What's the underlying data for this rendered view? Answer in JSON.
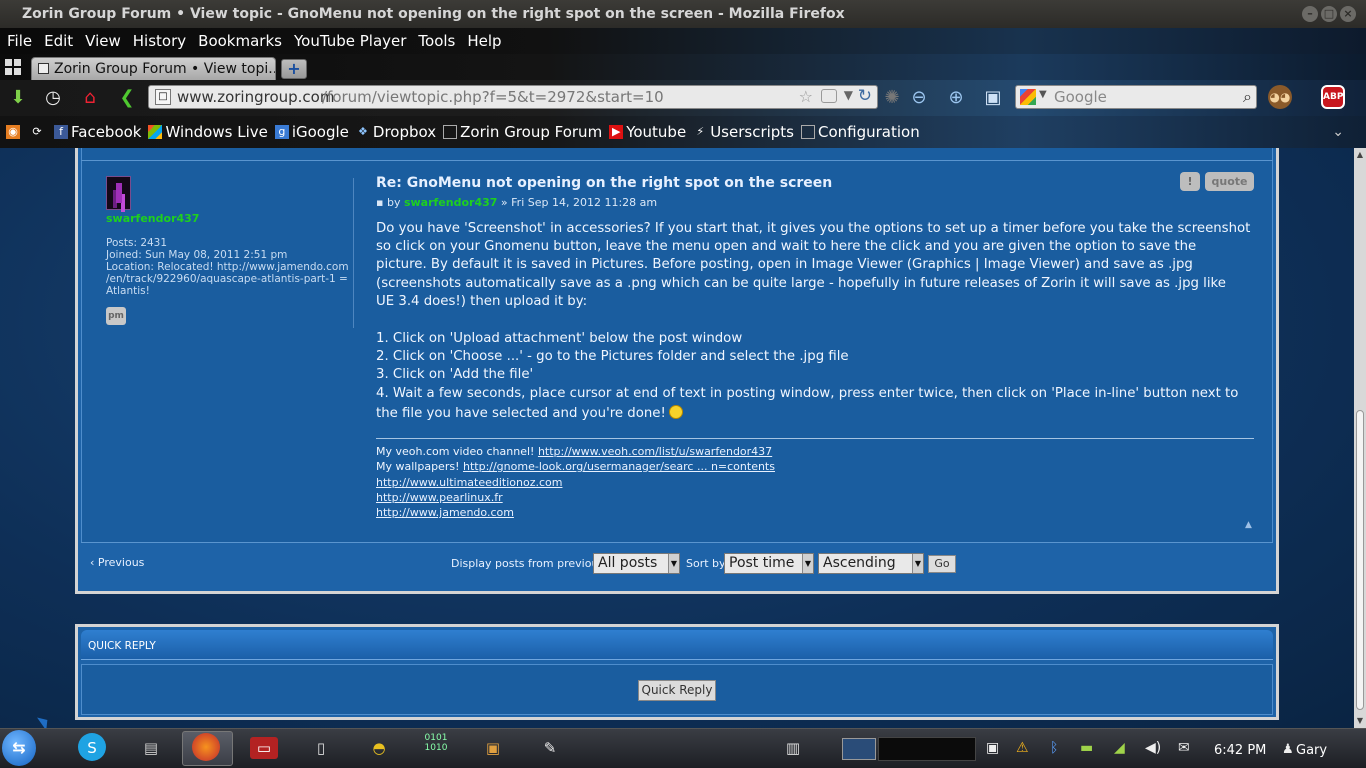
{
  "window": {
    "title": "Zorin Group Forum • View topic - GnoMenu not opening on the right spot on the screen - Mozilla Firefox"
  },
  "menubar": {
    "items": [
      "File",
      "Edit",
      "View",
      "History",
      "Bookmarks",
      "YouTube Player",
      "Tools",
      "Help"
    ]
  },
  "tabs": {
    "active_label": "Zorin Group Forum • View topi...",
    "new_tab_label": "+"
  },
  "navbar": {
    "url_host": "www.zoringroup.com",
    "url_path": "/forum/viewtopic.php?f=5&t=2972&start=10",
    "search_placeholder": "Google",
    "abp_label": "ABP"
  },
  "bookmarks": {
    "items": [
      "Facebook",
      "Windows Live",
      "iGoogle",
      "Dropbox",
      "Zorin Group Forum",
      "Youtube",
      "Userscripts",
      "Configuration"
    ]
  },
  "post": {
    "author": "swarfendor437",
    "profile": {
      "posts": "Posts: 2431",
      "joined": "Joined: Sun May 08, 2011 2:51 pm",
      "location_1": "Location: Relocated! http://www.jamendo.com",
      "location_2": "/en/track/922960/aquascape-atlantis-part-1 =",
      "location_3": "Atlantis!"
    },
    "pm_label": "pm",
    "report_label": "!",
    "quote_label": "quote",
    "title": "Re: GnoMenu not opening on the right spot on the screen",
    "meta_by": "by",
    "meta_date": "» Fri Sep 14, 2012 11:28 am",
    "body_lines": [
      "Do you have 'Screenshot' in accessories? If you start that, it gives you the options to set up a timer before you take the screenshot",
      "so click on your Gnomenu button, leave the menu open and wait to here the click and you are given the option to save the",
      "picture. By default it is saved in Pictures. Before posting, open in Image Viewer (Graphics | Image Viewer) and save as .jpg",
      "(screenshots automatically save as a .png which can be quite large - hopefully in future releases of Zorin it will save as .jpg like",
      "UE 3.4 does!) then upload it by:"
    ],
    "steps": [
      "1. Click on 'Upload attachment' below the post window",
      "2. Click on 'Choose ...' - go to the Pictures folder and select the .jpg file",
      "3. Click on 'Add the file'",
      "4. Wait a few seconds, place cursor at end of text in posting window, press enter twice, then click on 'Place in-line' button next to",
      "the file you have selected and you're done!"
    ],
    "signature": {
      "veoh_label": "My veoh.com video channel!",
      "veoh_link": "http://www.veoh.com/list/u/swarfendor437",
      "wallpapers_label": "My wallpapers!",
      "wallpapers_link": "http://gnome-look.org/usermanager/searc ... n=contents",
      "links": [
        "http://www.ultimateeditionoz.com",
        "http://www.pearlinux.fr",
        "http://www.jamendo.com"
      ]
    }
  },
  "pagination": {
    "previous": "Previous",
    "display_label": "Display posts from previous:",
    "display_value": "All posts",
    "sort_label": "Sort by",
    "sort_value": "Post time",
    "order_value": "Ascending",
    "go_label": "Go"
  },
  "quick_reply": {
    "title": "QUICK REPLY",
    "button": "Quick Reply"
  },
  "taskbar": {
    "clock": "6:42 PM",
    "user": "Gary"
  }
}
